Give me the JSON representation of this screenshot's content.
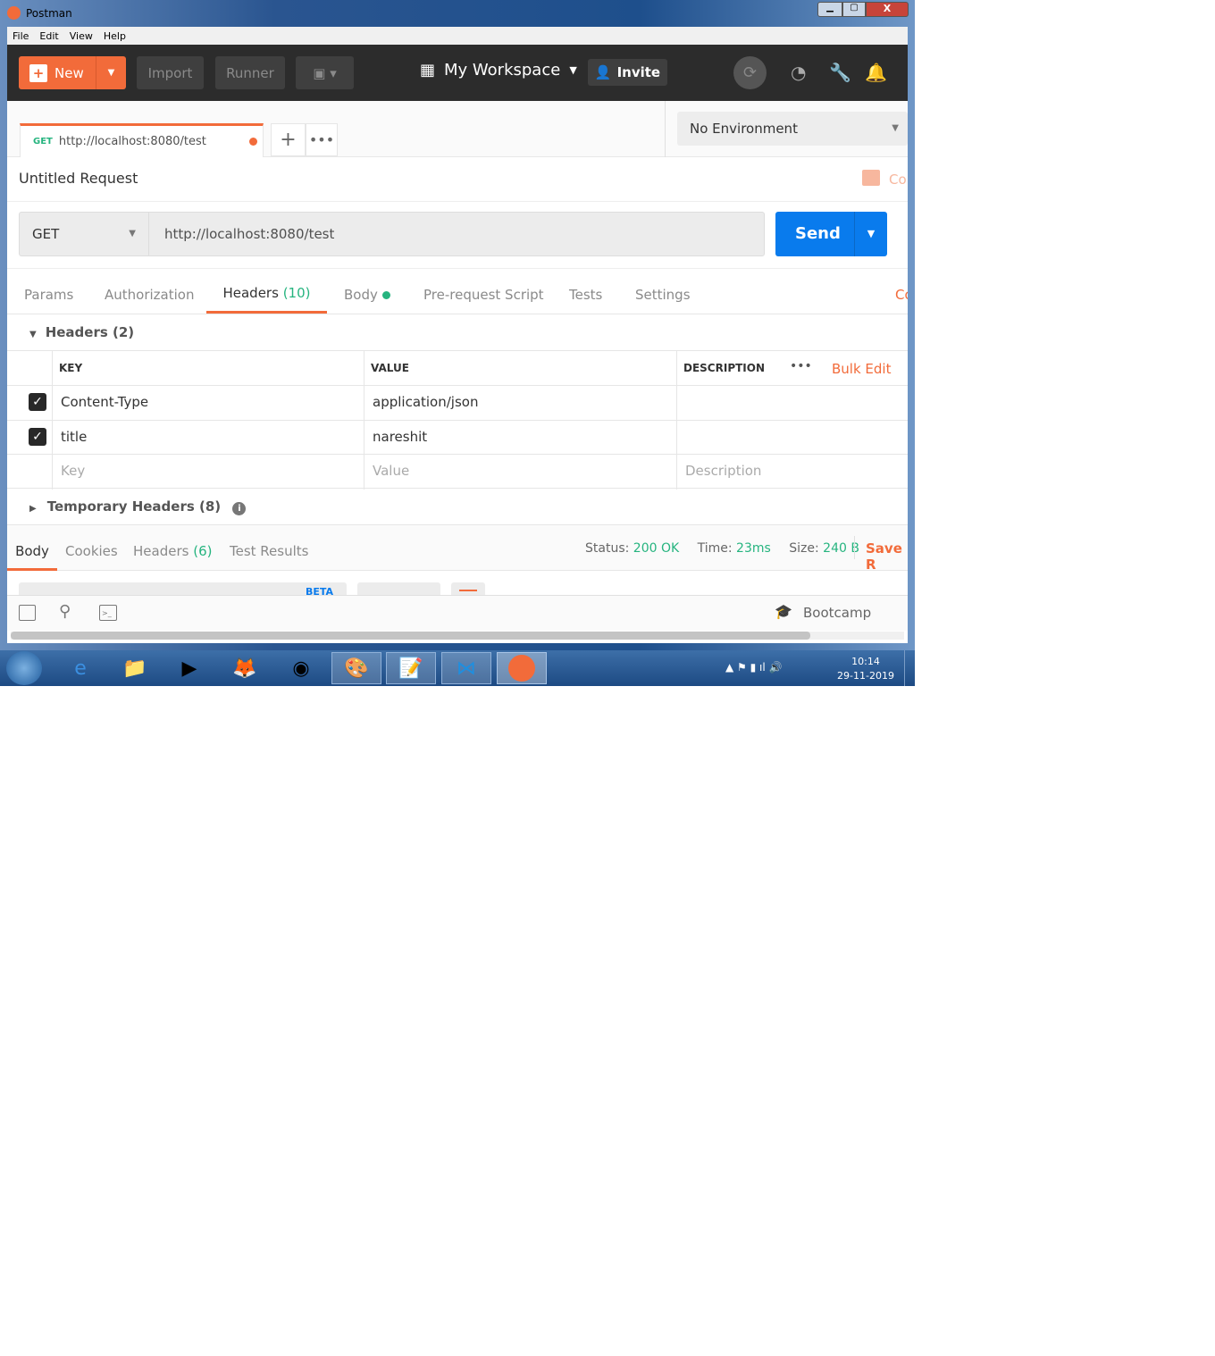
{
  "window": {
    "title": "Postman",
    "menu": [
      "File",
      "Edit",
      "View",
      "Help"
    ]
  },
  "header": {
    "new": "New",
    "import": "Import",
    "runner": "Runner",
    "workspace": "My Workspace",
    "invite": "Invite"
  },
  "tab": {
    "method": "GET",
    "url": "http://localhost:8080/test"
  },
  "environment": "No Environment",
  "request": {
    "title": "Untitled Request",
    "comments": "Co",
    "method": "GET",
    "url": "http://localhost:8080/test",
    "send": "Send"
  },
  "req_tabs": {
    "params": "Params",
    "authorization": "Authorization",
    "headers": "Headers",
    "headers_count": "(10)",
    "body": "Body",
    "prerequest": "Pre-request Script",
    "tests": "Tests",
    "settings": "Settings",
    "cookies": "Co"
  },
  "headers_section": {
    "title": "Headers (2)",
    "columns": {
      "key": "KEY",
      "value": "VALUE",
      "description": "DESCRIPTION"
    },
    "bulk_edit": "Bulk Edit",
    "rows": [
      {
        "key": "Content-Type",
        "value": "application/json",
        "checked": true
      },
      {
        "key": "title",
        "value": "nareshit",
        "checked": true
      }
    ],
    "placeholders": {
      "key": "Key",
      "value": "Value",
      "description": "Description"
    },
    "temporary": "Temporary Headers (8)"
  },
  "response": {
    "tabs": {
      "body": "Body",
      "cookies": "Cookies",
      "headers": "Headers",
      "headers_count": "(6)",
      "test_results": "Test Results"
    },
    "status_label": "Status:",
    "status": "200 OK",
    "time_label": "Time:",
    "time": "23ms",
    "size_label": "Size:",
    "size": "240 B",
    "save": "Save R",
    "beta": "BETA"
  },
  "footer": {
    "bootcamp": "Bootcamp"
  },
  "taskbar": {
    "time": "10:14",
    "date": "29-11-2019"
  },
  "colors": {
    "accent": "#f26b3a",
    "send": "#097bed",
    "success": "#26b47f"
  }
}
